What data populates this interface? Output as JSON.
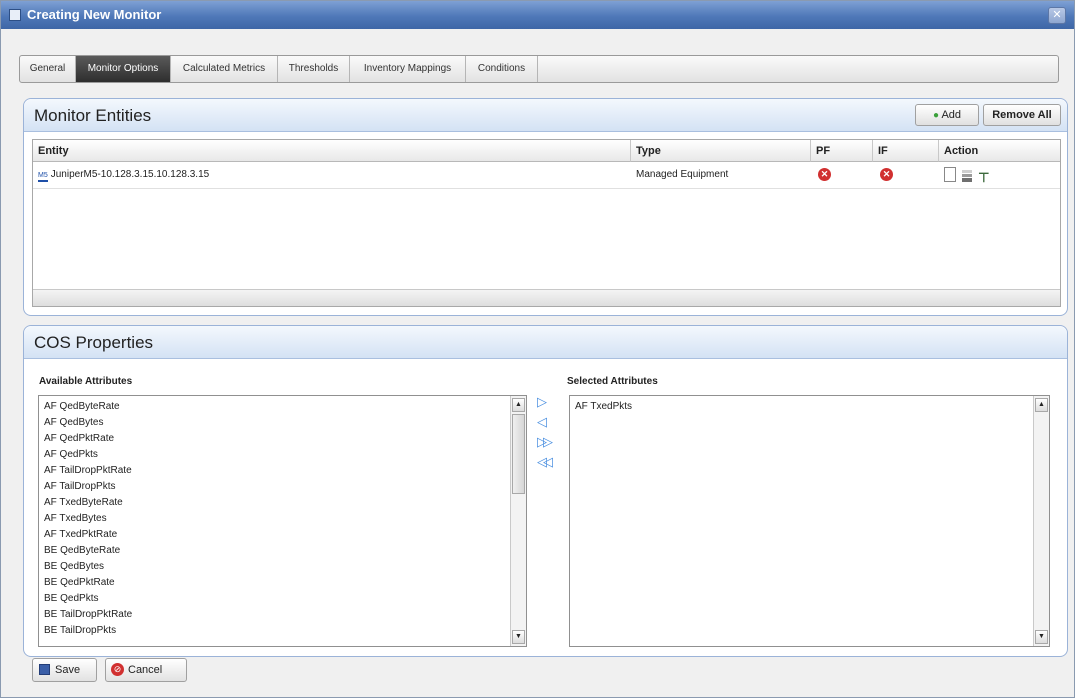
{
  "window": {
    "title": "Creating New Monitor",
    "close_label": "✕"
  },
  "tabs": [
    {
      "label": "General"
    },
    {
      "label": "Monitor Options"
    },
    {
      "label": "Calculated Metrics"
    },
    {
      "label": "Thresholds"
    },
    {
      "label": "Inventory Mappings"
    },
    {
      "label": "Conditions"
    }
  ],
  "active_tab": "Monitor Options",
  "monitor_entities": {
    "title": "Monitor Entities",
    "add_label": "Add",
    "remove_all_label": "Remove All",
    "columns": [
      "Entity",
      "Type",
      "PF",
      "IF",
      "Action"
    ],
    "rows": [
      {
        "entity": "JuniperM5-10.128.3.15.10.128.3.15",
        "type": "Managed Equipment",
        "icon_text": "M5"
      }
    ]
  },
  "cos": {
    "title": "COS Properties",
    "available_label": "Available Attributes",
    "selected_label": "Selected Attributes",
    "available": [
      "AF QedByteRate",
      "AF QedBytes",
      "AF QedPktRate",
      "AF QedPkts",
      "AF TailDropPktRate",
      "AF TailDropPkts",
      "AF TxedByteRate",
      "AF TxedBytes",
      "AF TxedPktRate",
      "BE QedByteRate",
      "BE QedBytes",
      "BE QedPktRate",
      "BE QedPkts",
      "BE TailDropPktRate",
      "BE TailDropPkts"
    ],
    "selected": [
      "AF TxedPkts"
    ]
  },
  "footer": {
    "save_label": "Save",
    "cancel_label": "Cancel"
  },
  "colors": {
    "accent": "#4f78b8",
    "error": "#d13030",
    "active_tab": "#3a3a3a"
  }
}
